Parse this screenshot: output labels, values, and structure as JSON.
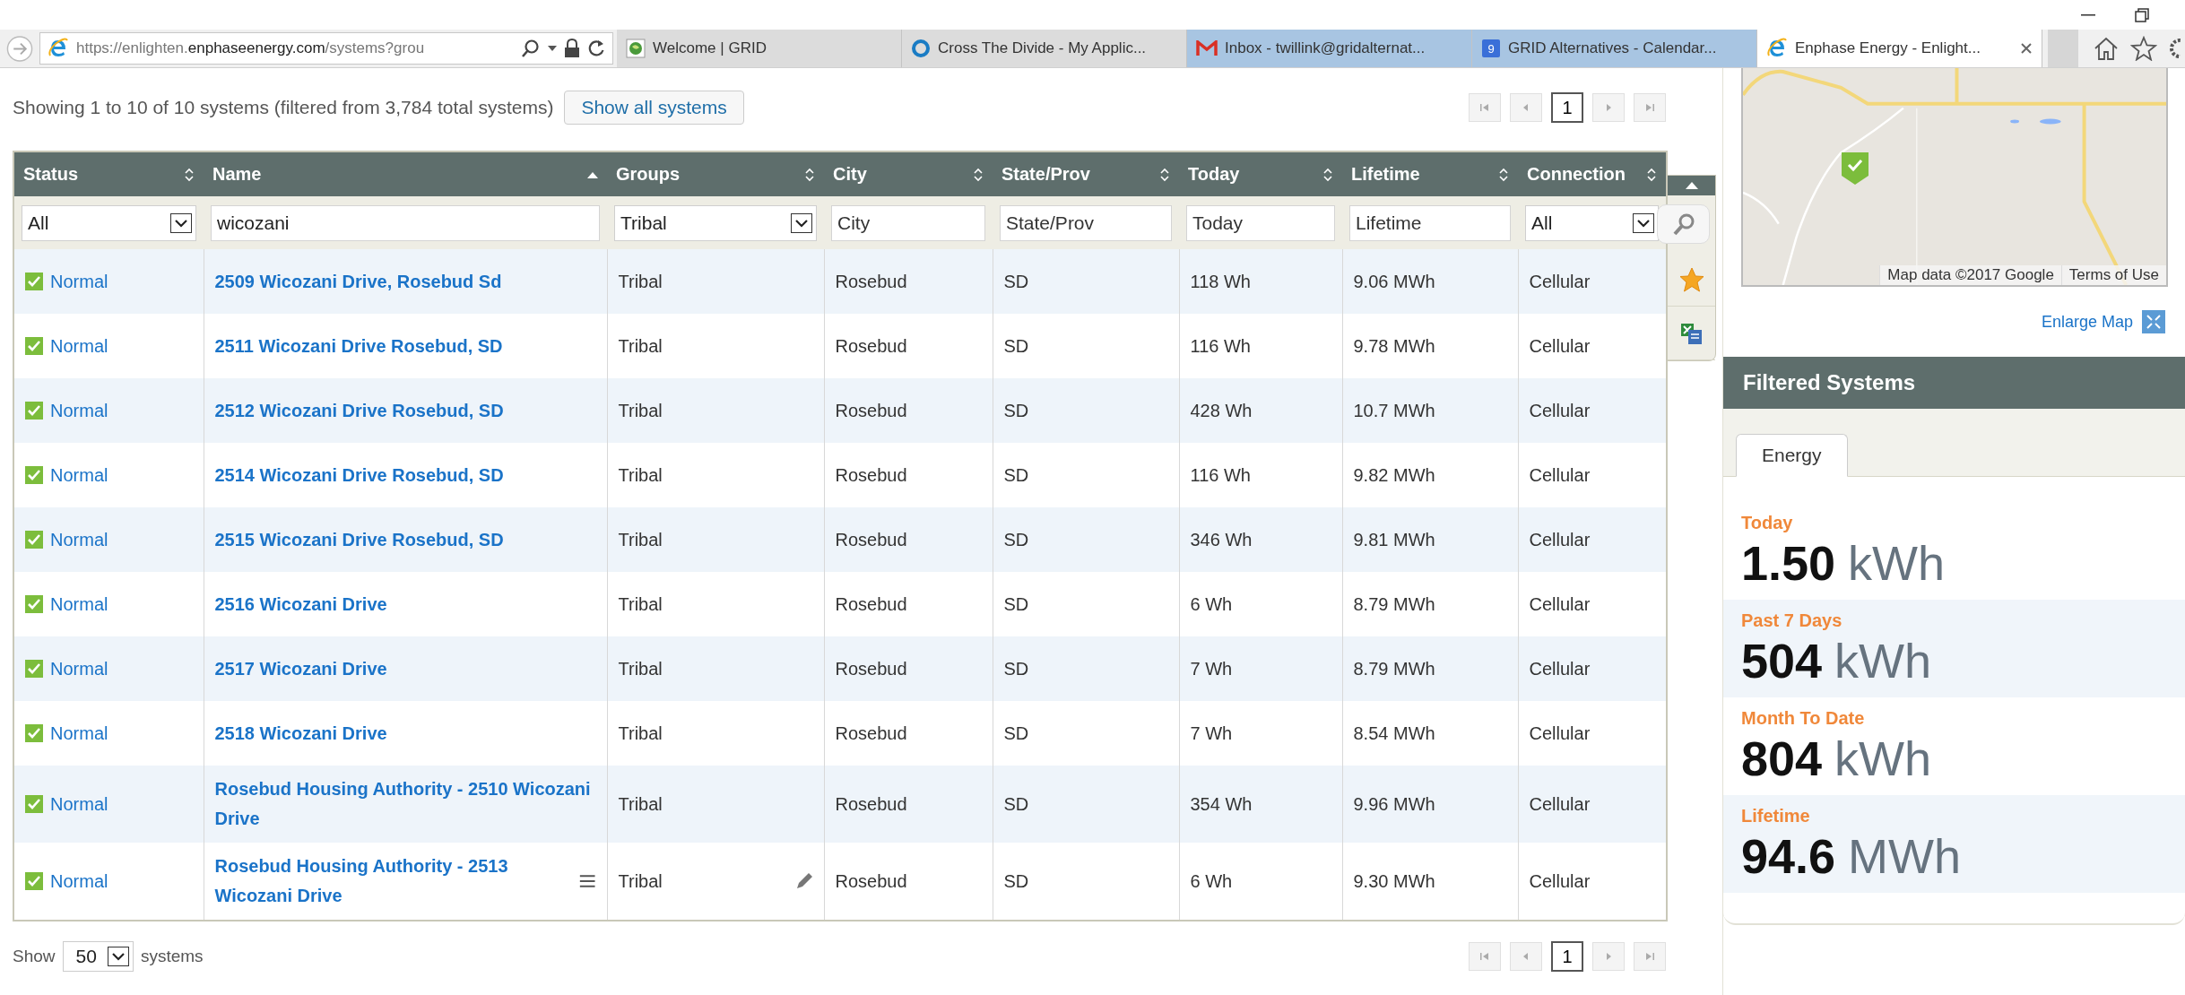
{
  "browser": {
    "address": "https://enlighten.**enphaseenergy.com**/systems?grou",
    "tabs": [
      {
        "title": "Welcome | GRID",
        "selected": false,
        "color": "#dcdcdc",
        "kind": "grid"
      },
      {
        "title": "Cross The Divide - My Applic...",
        "selected": false,
        "color": "#dcdcdc",
        "kind": "ring"
      },
      {
        "title": "Inbox - twillink@gridalternat...",
        "selected": false,
        "color": "#a8c5e2",
        "kind": "mail"
      },
      {
        "title": "GRID Alternatives - Calendar...",
        "selected": false,
        "color": "#a8c5e2",
        "kind": "calendar",
        "badge": "9"
      },
      {
        "title": "Enphase Energy - Enlight...",
        "selected": true,
        "color": "#ffffff",
        "kind": "ie"
      }
    ]
  },
  "summary": "Showing 1 to 10 of 10 systems (filtered from 3,784 total systems)",
  "show_all_button": "Show all systems",
  "pager_top": {
    "pages": [
      {
        "label": "1",
        "selected": true
      }
    ]
  },
  "table": {
    "columns": [
      {
        "label": "Status",
        "sorted": false
      },
      {
        "label": "Name",
        "sorted": true
      },
      {
        "label": "Groups",
        "sorted": false
      },
      {
        "label": "City",
        "sorted": false
      },
      {
        "label": "State/Prov",
        "sorted": false
      },
      {
        "label": "Today",
        "sorted": false
      },
      {
        "label": "Lifetime",
        "sorted": false
      },
      {
        "label": "Connection",
        "sorted": false
      }
    ],
    "filters": [
      {
        "kind": "select",
        "value": "All"
      },
      {
        "kind": "text",
        "value": "wicozani"
      },
      {
        "kind": "select",
        "value": "Tribal"
      },
      {
        "kind": "text",
        "placeholder": "City"
      },
      {
        "kind": "text",
        "placeholder": "State/Prov"
      },
      {
        "kind": "text",
        "placeholder": "Today"
      },
      {
        "kind": "text",
        "placeholder": "Lifetime"
      },
      {
        "kind": "select",
        "value": "All"
      }
    ],
    "rows": [
      {
        "status": "Normal",
        "name": "2509 Wicozani Drive, Rosebud Sd",
        "group": "Tribal",
        "city": "Rosebud",
        "state": "SD",
        "today": "118 Wh",
        "lifetime": "9.06 MWh",
        "connection": "Cellular",
        "hovered": false
      },
      {
        "status": "Normal",
        "name": "2511 Wicozani Drive Rosebud, SD",
        "group": "Tribal",
        "city": "Rosebud",
        "state": "SD",
        "today": "116 Wh",
        "lifetime": "9.78 MWh",
        "connection": "Cellular",
        "hovered": false
      },
      {
        "status": "Normal",
        "name": "2512 Wicozani Drive Rosebud, SD",
        "group": "Tribal",
        "city": "Rosebud",
        "state": "SD",
        "today": "428 Wh",
        "lifetime": "10.7 MWh",
        "connection": "Cellular",
        "hovered": false
      },
      {
        "status": "Normal",
        "name": "2514 Wicozani Drive Rosebud, SD",
        "group": "Tribal",
        "city": "Rosebud",
        "state": "SD",
        "today": "116 Wh",
        "lifetime": "9.82 MWh",
        "connection": "Cellular",
        "hovered": false
      },
      {
        "status": "Normal",
        "name": "2515 Wicozani Drive Rosebud, SD",
        "group": "Tribal",
        "city": "Rosebud",
        "state": "SD",
        "today": "346 Wh",
        "lifetime": "9.81 MWh",
        "connection": "Cellular",
        "hovered": false
      },
      {
        "status": "Normal",
        "name": "2516 Wicozani Drive",
        "group": "Tribal",
        "city": "Rosebud",
        "state": "SD",
        "today": "6 Wh",
        "lifetime": "8.79 MWh",
        "connection": "Cellular",
        "hovered": false
      },
      {
        "status": "Normal",
        "name": "2517 Wicozani Drive",
        "group": "Tribal",
        "city": "Rosebud",
        "state": "SD",
        "today": "7 Wh",
        "lifetime": "8.79 MWh",
        "connection": "Cellular",
        "hovered": false
      },
      {
        "status": "Normal",
        "name": "2518 Wicozani Drive",
        "group": "Tribal",
        "city": "Rosebud",
        "state": "SD",
        "today": "7 Wh",
        "lifetime": "8.54 MWh",
        "connection": "Cellular",
        "hovered": false
      },
      {
        "status": "Normal",
        "name": "Rosebud Housing Authority - 2510 Wicozani Drive",
        "group": "Tribal",
        "city": "Rosebud",
        "state": "SD",
        "today": "354 Wh",
        "lifetime": "9.96 MWh",
        "connection": "Cellular",
        "hovered": false
      },
      {
        "status": "Normal",
        "name": "Rosebud Housing Authority - 2513 Wicozani Drive",
        "group": "Tribal",
        "city": "Rosebud",
        "state": "SD",
        "today": "6 Wh",
        "lifetime": "9.30 MWh",
        "connection": "Cellular",
        "hovered": true
      }
    ]
  },
  "footer": {
    "show_label": "Show",
    "page_size": "50",
    "systems_label": "systems"
  },
  "pager_bottom": {
    "pages": [
      {
        "label": "1",
        "selected": true
      }
    ]
  },
  "map": {
    "kind": "picture",
    "attribution": "Map data ©2017 Google",
    "terms": "Terms of Use",
    "enlarge": "Enlarge Map"
  },
  "filtered": {
    "title": "Filtered Systems",
    "tabs": [
      {
        "label": "Energy",
        "selected": true
      }
    ],
    "stats": [
      {
        "label": "Today",
        "value": "1.50",
        "unit": "kWh"
      },
      {
        "label": "Past 7 Days",
        "value": "504",
        "unit": "kWh"
      },
      {
        "label": "Month To Date",
        "value": "804",
        "unit": "kWh"
      },
      {
        "label": "Lifetime",
        "value": "94.6",
        "unit": "MWh"
      }
    ]
  }
}
